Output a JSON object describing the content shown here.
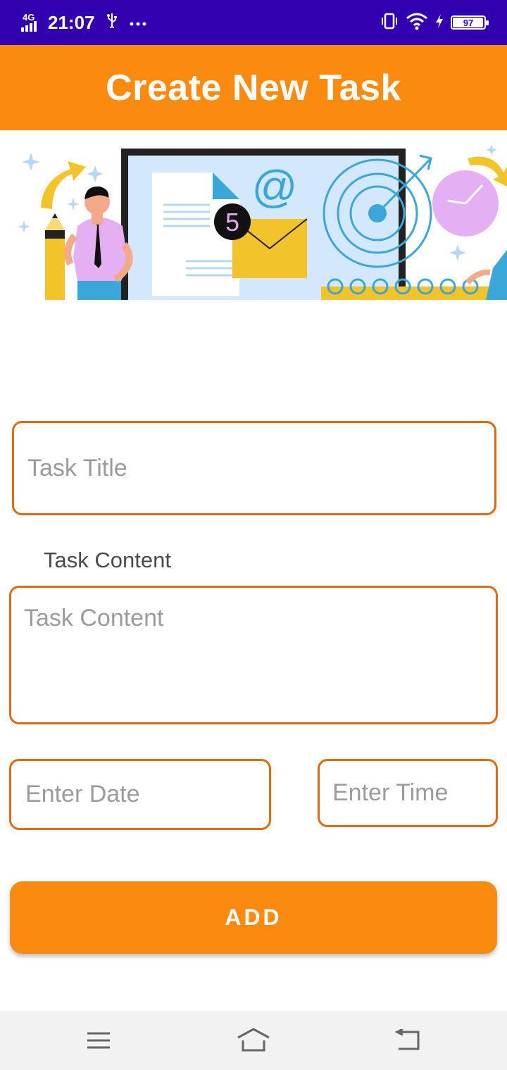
{
  "status_bar": {
    "network": "4G",
    "time": "21:07",
    "usb_icon": "usb-icon",
    "more_icon": "more-dots-icon",
    "vibrate_icon": "vibrate-icon",
    "wifi_icon": "wifi-icon",
    "charging_icon": "charging-icon",
    "battery_level": "97",
    "battery_fraction": 0.97
  },
  "header": {
    "title": "Create New Task",
    "color": "#fb8a10"
  },
  "banner": {
    "badge": "5",
    "at_symbol": "@"
  },
  "form": {
    "title_placeholder": "Task Title",
    "content_label": "Task Content",
    "content_placeholder": "Task Content",
    "date_placeholder": "Enter Date",
    "time_placeholder": "Enter Time",
    "add_label": "ADD",
    "border_color": "#e06a12"
  },
  "nav": {
    "menu_icon": "menu-icon",
    "home_icon": "home-icon",
    "back_icon": "back-icon"
  }
}
